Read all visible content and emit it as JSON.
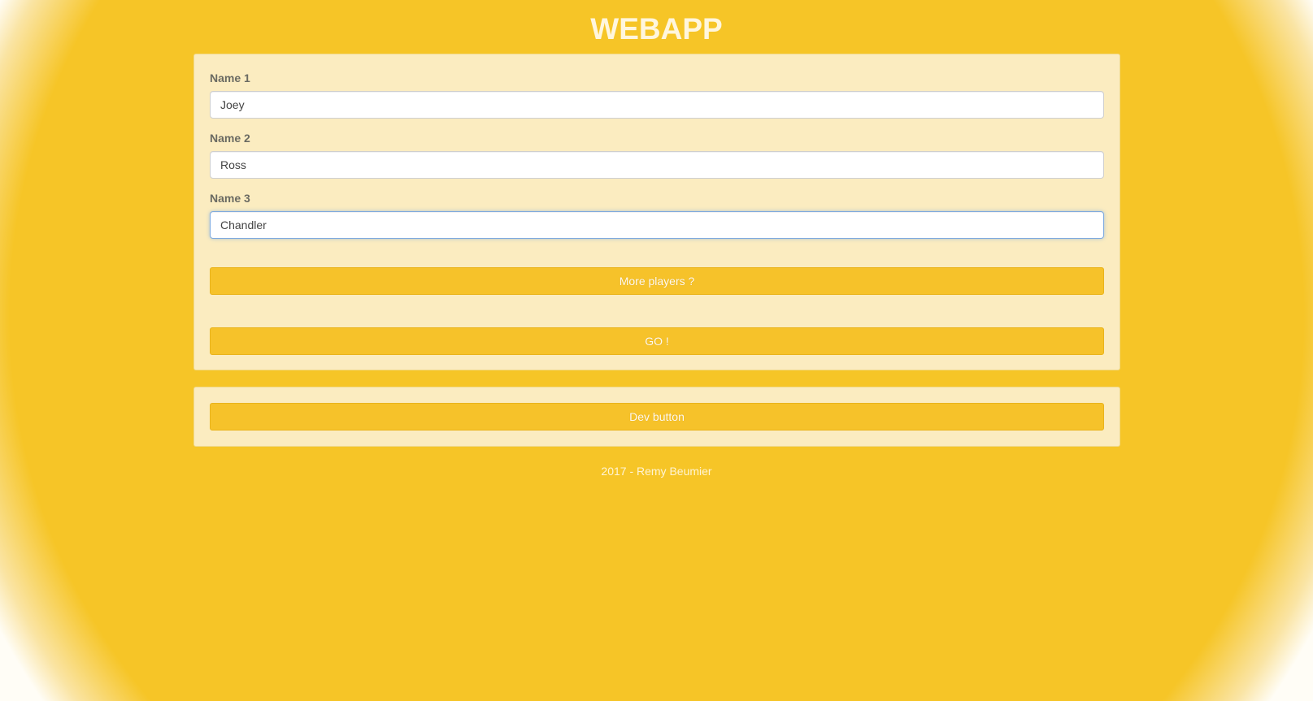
{
  "header": {
    "title": "WEBAPP"
  },
  "form": {
    "fields": [
      {
        "label": "Name 1",
        "value": "Joey"
      },
      {
        "label": "Name 2",
        "value": "Ross"
      },
      {
        "label": "Name 3",
        "value": "Chandler"
      }
    ],
    "more_players_label": "More players ?",
    "go_label": "GO !"
  },
  "dev": {
    "button_label": "Dev button"
  },
  "footer": {
    "text": "2017 - Remy Beumier"
  },
  "colors": {
    "background": "#f6c527",
    "panel": "#fbecc0",
    "button": "#f6c22a",
    "title": "#fff6dd"
  }
}
